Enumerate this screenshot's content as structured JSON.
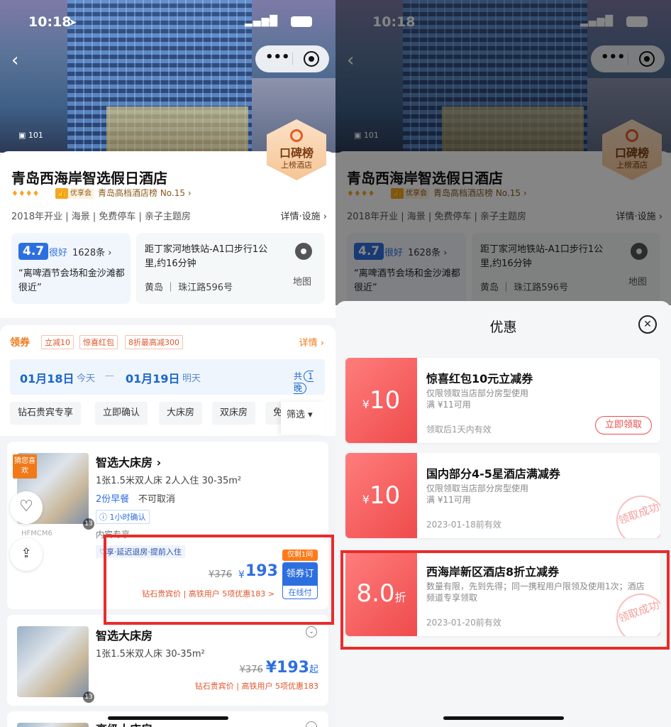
{
  "status": {
    "time": "10:18"
  },
  "hotel": {
    "photo_count": "101",
    "badge_line1": "口碑榜",
    "badge_line2": "上榜酒店",
    "name": "青岛西海岸智选假日酒店",
    "stars": "♦♦♦♦",
    "vip_tag": "优享会",
    "rank": "青岛高档酒店榜 No.15",
    "tags": "2018年开业 | 海景 | 免费停车 | 亲子主题房",
    "detail_link": "详情·设施",
    "score": "4.7",
    "score_word": "很好",
    "reviews": "1628条",
    "quote": "“离啤酒节会场和金沙滩都很近”",
    "address": "距丁家河地铁站-A1口步行1公里,约16分钟",
    "district": "黄岛 ｜ 珠江路596号",
    "map_label": "地图"
  },
  "coupons_strip": {
    "label": "领券",
    "tags": [
      "立减10",
      "惊喜红包",
      "8折最高减300"
    ],
    "detail": "详情"
  },
  "dates": {
    "checkin": "01月18日",
    "checkin_day": "今天",
    "dash": "—",
    "checkout": "01月19日",
    "checkout_day": "明天",
    "total": "共",
    "nights": "1晚"
  },
  "filters": [
    "钻石贵宾专享",
    "立即确认",
    "大床房",
    "双床房",
    "免"
  ],
  "filter_screen": "筛选 ▾",
  "room1": {
    "guess": "猜您喜欢",
    "img_count": "13",
    "code": "HFMCM6",
    "title": "智选大床房",
    "desc": "1张1.5米双人床 2人入住 30-35m²",
    "breakfast": "2份早餐",
    "cancel": "不可取消",
    "confirm": "1小时确认",
    "inner": "内宾专享",
    "perk": "享·延迟退房·提前入住",
    "old_price": "¥376",
    "currency": "¥",
    "price": "193",
    "left": "仅剩1间",
    "book_top": "领券订",
    "book_bottom": "在线付",
    "vip_line": "钻石贵宾价 | 高铁用户 5项优惠183 >"
  },
  "room2": {
    "title": "智选大床房",
    "desc": "1张1.5米双人床 30-35m²",
    "img_count": "13",
    "old_price": "¥376",
    "price": "¥193",
    "suffix": "起",
    "vip_line": "钻石贵宾价 | 高铁用户 5项优惠183"
  },
  "room3": {
    "title": "高级大床房"
  },
  "sheet": {
    "title": "优惠",
    "coupons": [
      {
        "amount": "10",
        "prefix": "¥",
        "title": "惊喜红包10元立减券",
        "desc": "仅限领取当店部分房型使用\n满 ¥11可用",
        "expiry": "领取后1天内有效",
        "button": "立即领取"
      },
      {
        "amount": "10",
        "prefix": "¥",
        "title": "国内部分4-5星酒店满减券",
        "desc": "仅限领取当店部分房型使用\n满 ¥11可用",
        "expiry": "2023-01-18前有效",
        "stamp": "领取成功"
      },
      {
        "amount": "8.0",
        "suffix": "折",
        "title": "西海岸新区酒店8折立减券",
        "desc": "数量有限，先到先得；同一携程用户限领及使用1次；酒店频道专享领取",
        "expiry": "2023-01-20前有效",
        "stamp": "领取成功"
      }
    ]
  }
}
